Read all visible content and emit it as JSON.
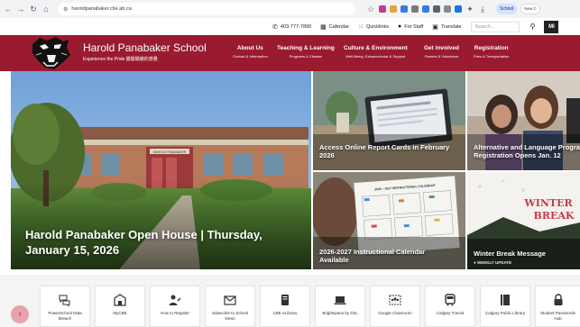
{
  "browser": {
    "url": "haroldpanabaker.cbe.ab.ca",
    "profile_label": "School",
    "new_chrome_label": "New C"
  },
  "utility": {
    "phone": "403-777-7890",
    "calendar": "Calendar",
    "quicklinks": "Quicklinks",
    "for_staff": "For Staff",
    "translate": "Translate",
    "search_placeholder": "Search...",
    "lang_label": "Ml"
  },
  "header": {
    "school_name": "Harold Panabaker School",
    "tagline": "Experience the Pride 體驗驕傲的感覺",
    "nav": [
      {
        "label": "About Us",
        "sub": "Contact & Information"
      },
      {
        "label": "Teaching & Learning",
        "sub": "Programs & Classes"
      },
      {
        "label": "Culture & Environment",
        "sub": "Well-Being, Extracurricular & Support"
      },
      {
        "label": "Get Involved",
        "sub": "Parents & Volunteers"
      },
      {
        "label": "Registration",
        "sub": "Fees & Transportation"
      }
    ]
  },
  "hero": {
    "caption": "Harold Panabaker Open House | Thursday, January 15, 2026",
    "building_sign": "HAROLD PANABAKER"
  },
  "tiles": [
    {
      "title": "Access Online Report Cards in February 2026"
    },
    {
      "title": "Alternative and Language Program Registration Opens Jan. 12"
    },
    {
      "title": "2026-2027 Instructional Calendar Available",
      "doc_heading": "2026 – 2027 INSTRUCTIONAL CALENDAR"
    },
    {
      "title": "Winter Break Message",
      "tag": "● WEEKLY UPDATE",
      "art_text_1": "WINTER",
      "art_text_2": "BREAK"
    }
  ],
  "quicklinks": [
    {
      "label": "PowerSchool Data Breach",
      "icon": "chat-bubbles-icon"
    },
    {
      "label": "MyCBE",
      "icon": "school-building-icon"
    },
    {
      "label": "How to Register",
      "icon": "person-pen-icon"
    },
    {
      "label": "Subscribe to School News",
      "icon": "envelope-icon"
    },
    {
      "label": "CBE eLibrary",
      "icon": "ebook-icon"
    },
    {
      "label": "Brightspace by D2L",
      "icon": "laptop-icon"
    },
    {
      "label": "Google Classroom",
      "icon": "classroom-icon"
    },
    {
      "label": "Calgary Transit",
      "icon": "bus-icon"
    },
    {
      "label": "Calgary Public Library",
      "icon": "book-icon"
    },
    {
      "label": "Student Passwords Hub",
      "icon": "lock-icon"
    }
  ],
  "colors": {
    "brand_maroon": "#9a1a2f",
    "quick_prev": "#e6a3ad"
  }
}
